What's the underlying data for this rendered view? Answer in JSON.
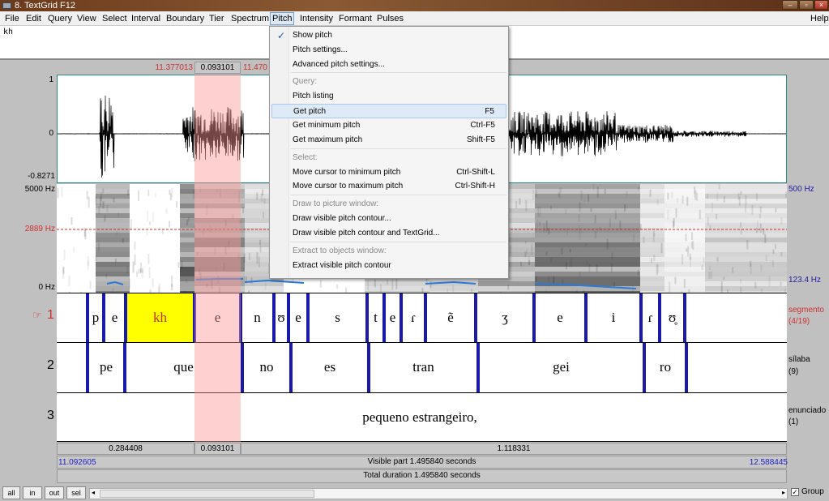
{
  "window": {
    "title": "8. TextGrid F12",
    "minimize": "–",
    "restore": "▫",
    "close": "×"
  },
  "menubar": {
    "items": [
      "File",
      "Edit",
      "Query",
      "View",
      "Select",
      "Interval",
      "Boundary",
      "Tier",
      "Spectrum",
      "Pitch",
      "Intensity",
      "Formant",
      "Pulses"
    ],
    "help": "Help",
    "open": "Pitch"
  },
  "text_field": {
    "value": "kh"
  },
  "selection_bar": {
    "start": "11.377013",
    "duration": "0.093101",
    "end": "11.470"
  },
  "waveform": {
    "max": "1",
    "zero": "0",
    "min": "-0.8271"
  },
  "spectrogram": {
    "top": "5000 Hz",
    "cursor": "2889 Hz",
    "bottom": "0 Hz",
    "pitch_top": "500 Hz",
    "pitch_bottom": "123.4 Hz",
    "pitch_color": "#2a7ad8"
  },
  "tiers": [
    {
      "number": "1",
      "name": "segmento",
      "count": "(4/19)",
      "selected": true,
      "pointer_icon": "☞",
      "intervals": [
        "p",
        "e",
        "kh",
        "e",
        "n",
        "ʊ",
        "e",
        "s",
        "t",
        "e",
        "ɾ",
        "ẽ",
        "ʒ",
        "e",
        "i",
        "ɾ",
        "ʊ̥"
      ],
      "selected_interval": "kh"
    },
    {
      "number": "2",
      "name": "sílaba",
      "count": "(9)",
      "intervals": [
        "pe",
        "que",
        "no",
        "es",
        "tran",
        "gei",
        "ro"
      ]
    },
    {
      "number": "3",
      "name": "enunciado",
      "count": "(1)",
      "intervals": [
        "pequeno estrangeiro,"
      ]
    }
  ],
  "durations": {
    "left": "0.284408",
    "selected": "0.093101",
    "right": "1.118331"
  },
  "visible": {
    "start": "11.092605",
    "label": "Visible part 1.495840 seconds",
    "end": "12.588445"
  },
  "total": {
    "label": "Total duration 1.495840 seconds"
  },
  "bottom_buttons": [
    "all",
    "in",
    "out",
    "sel"
  ],
  "group": {
    "label": "Group",
    "checked": true
  },
  "pitch_menu": [
    {
      "label": "Show pitch",
      "checked": true
    },
    {
      "label": "Pitch settings..."
    },
    {
      "label": "Advanced pitch settings..."
    },
    {
      "sep": true
    },
    {
      "label": "Query:",
      "header": true
    },
    {
      "label": "Pitch listing"
    },
    {
      "label": "Get pitch",
      "shortcut": "F5",
      "highlighted": true
    },
    {
      "label": "Get minimum pitch",
      "shortcut": "Ctrl-F5"
    },
    {
      "label": "Get maximum pitch",
      "shortcut": "Shift-F5"
    },
    {
      "sep": true
    },
    {
      "label": "Select:",
      "header": true
    },
    {
      "label": "Move cursor to minimum pitch",
      "shortcut": "Ctrl-Shift-L"
    },
    {
      "label": "Move cursor to maximum pitch",
      "shortcut": "Ctrl-Shift-H"
    },
    {
      "sep": true
    },
    {
      "label": "Draw to picture window:",
      "header": true
    },
    {
      "label": "Draw visible pitch contour..."
    },
    {
      "label": "Draw visible pitch contour and TextGrid..."
    },
    {
      "sep": true
    },
    {
      "label": "Extract to objects window:",
      "header": true
    },
    {
      "label": "Extract visible pitch contour"
    }
  ],
  "colors": {
    "selection": "#ffb0b0",
    "boundary": "#1a1aa8",
    "selected_interval": "#ffff00",
    "red_text": "#d03030",
    "blue_text": "#2020c0"
  }
}
